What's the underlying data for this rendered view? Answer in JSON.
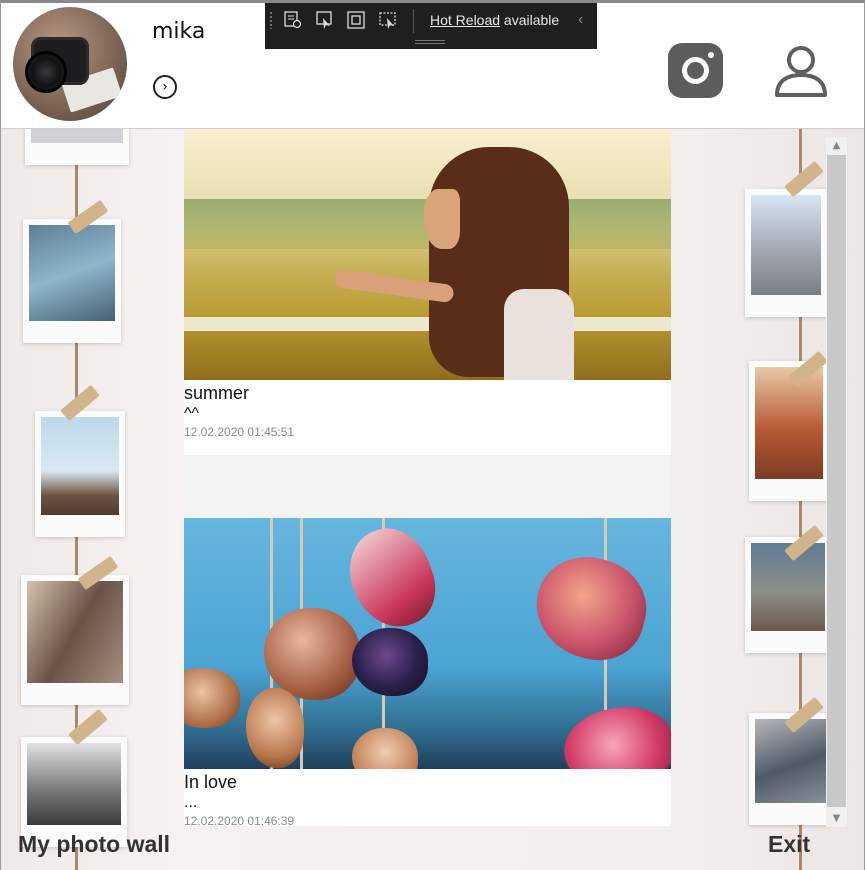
{
  "header": {
    "username": "mika",
    "chevron_glyph": "›",
    "icons": [
      "instagram-icon",
      "user-icon",
      "chevron-right-icon"
    ]
  },
  "devtools": {
    "hot_reload_link": "Hot Reload",
    "hot_reload_suffix": " available",
    "collapse_glyph": "‹",
    "tools": [
      "select-element-tool-icon",
      "display-layout-adorners-icon",
      "track-focus-icon",
      "preview-selection-icon"
    ]
  },
  "posts": [
    {
      "title": "summer",
      "caption": "^^",
      "date": "12.02.2020 01:45:51",
      "photo": "girl-in-field-photo"
    },
    {
      "title": "In love",
      "caption": "...",
      "date": "12.02.2020 01:46:39",
      "photo": "hanging-seashells-photo"
    }
  ],
  "footer": {
    "title": "My photo wall",
    "exit_label": "Exit"
  },
  "scrollbar": {
    "up_glyph": "▲",
    "down_glyph": "▼"
  },
  "colors": {
    "footer_text": "#333333",
    "devbar_bg": "#1f1f1f",
    "instagram_icon": "#5c5c5c"
  }
}
